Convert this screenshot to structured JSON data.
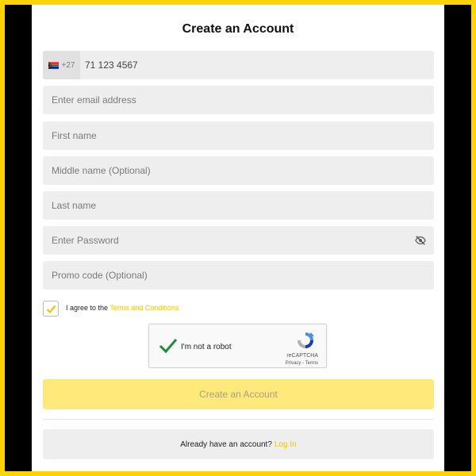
{
  "form": {
    "title": "Create an Account",
    "phone": {
      "country_code": "+27",
      "flag": "south-africa-flag-icon",
      "value": "71 123 4567"
    },
    "email_placeholder": "Enter email address",
    "first_name_placeholder": "First name",
    "middle_name_placeholder": "Middle name (Optional)",
    "last_name_placeholder": "Last name",
    "password_placeholder": "Enter Password",
    "promo_placeholder": "Promo code (Optional)",
    "terms": {
      "checked": true,
      "prefix": "I agree to the",
      "link": "Terms and Conditions"
    },
    "recaptcha": {
      "label": "I'm not a robot",
      "brand": "reCAPTCHA",
      "links": "Privacy - Terms"
    },
    "submit_label": "Create an Account",
    "login": {
      "prompt": "Already have an account?",
      "link": "Log In"
    }
  },
  "colors": {
    "accent": "#ffd400",
    "link": "#f5c400",
    "submit_bg": "#ffe97a",
    "field_bg": "#eeeeee"
  }
}
